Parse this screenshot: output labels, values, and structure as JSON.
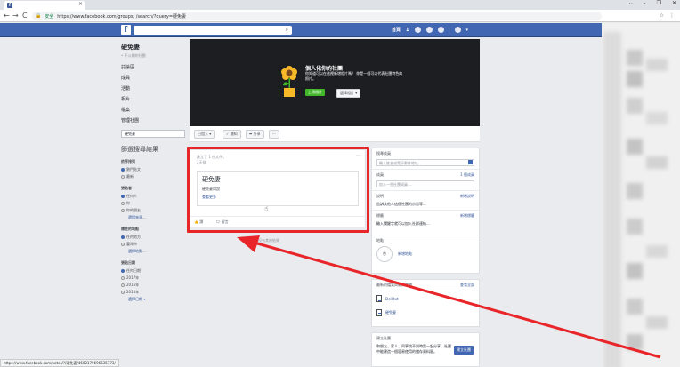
{
  "browser": {
    "tab_icon": "f",
    "window_controls": [
      "ᴗ",
      "–",
      "❐",
      "✕"
    ],
    "secure_label": "安全",
    "url": "https://www.facebook.com/groups/          /search/?query=硬免妻",
    "nav": {
      "back": "←",
      "forward": "→",
      "reload": "C"
    }
  },
  "fb_header": {
    "logo": "f",
    "user_name": "首頁",
    "badge": "1"
  },
  "left": {
    "group_name": "硬免妻",
    "group_type": "• 不公開的社團",
    "nav_items": [
      "討論區",
      "成員",
      "活動",
      "相片",
      "檔案",
      "管理社團"
    ],
    "search_value": "硬免妻",
    "filter_title": "篩選搜尋結果",
    "filters": [
      {
        "heading": "依序排列",
        "options": [
          {
            "label": "熱門貼文",
            "on": true
          },
          {
            "label": "最新",
            "on": false
          }
        ]
      },
      {
        "heading": "張貼者",
        "options": [
          {
            "label": "任何人",
            "on": true
          },
          {
            "label": "你",
            "on": false
          },
          {
            "label": "你的朋友",
            "on": false
          },
          {
            "label": "選擇來源...",
            "on": false,
            "link": true
          }
        ]
      },
      {
        "heading": "標註的地點",
        "options": [
          {
            "label": "任何地方",
            "on": true
          },
          {
            "label": "臺灣市",
            "on": false
          },
          {
            "label": "選擇地點...",
            "on": false,
            "link": true
          }
        ]
      },
      {
        "heading": "張貼日期",
        "options": [
          {
            "label": "任何日期",
            "on": true
          },
          {
            "label": "2017年",
            "on": false
          },
          {
            "label": "2016年",
            "on": false
          },
          {
            "label": "2015年",
            "on": false
          },
          {
            "label": "選擇日期 ▾",
            "on": false,
            "link": true
          }
        ]
      }
    ]
  },
  "cover": {
    "title": "個人化你的社團",
    "desc": "你知道可以在這裡新增相片嗎？\n你是一個可以代表社團特色的照片。",
    "upload_label": "上傳相片",
    "choose_label": "選擇相片 ▾"
  },
  "actions": {
    "joined": "已加入 ▾",
    "notify": "✓ 通知",
    "share": "➦ 分享",
    "more": "···"
  },
  "post": {
    "meta_line1": "建立了 1 份文件。",
    "meta_line2": "2天前",
    "more": "···",
    "attach_title": "硬免妻",
    "attach_desc": "硬免妻用說",
    "attach_link": "查看更多",
    "like": "讚",
    "comment": "留言"
  },
  "no_more": "沒有其他結果",
  "right": {
    "search_label": "搜尋成員",
    "search_placeholder": "輸入姓名或電子郵件地址...",
    "members_label": "成員",
    "members_count": "1 個成員",
    "members_sub": "加入一些社團成員 ...",
    "desc_label": "說明",
    "desc_edit": "新增說明",
    "desc_text": "告訴其他人這個社團的宗旨等...",
    "tags_label": "標籤",
    "tags_edit": "新增標籤",
    "tags_text": "輸入關鍵字就可以加入社群連結...",
    "location_label": "地點",
    "location_link": "新增地點",
    "files_label": "最新的檔案與最新編輯",
    "files_link": "查看全部",
    "files": [
      "Dell.txt",
      "硬免妻"
    ],
    "suggest_label": "建立社團",
    "suggest_text": "和朋友、家人、同事找不到時是一起分享，社團中能建造一個容易使用的儲存資料區。",
    "suggest_btn": "建立社團"
  },
  "status": "https://www.facebook.com/notes/?/硬免妻/4602179696535173/",
  "annotation": {
    "color": "#e8262a"
  }
}
